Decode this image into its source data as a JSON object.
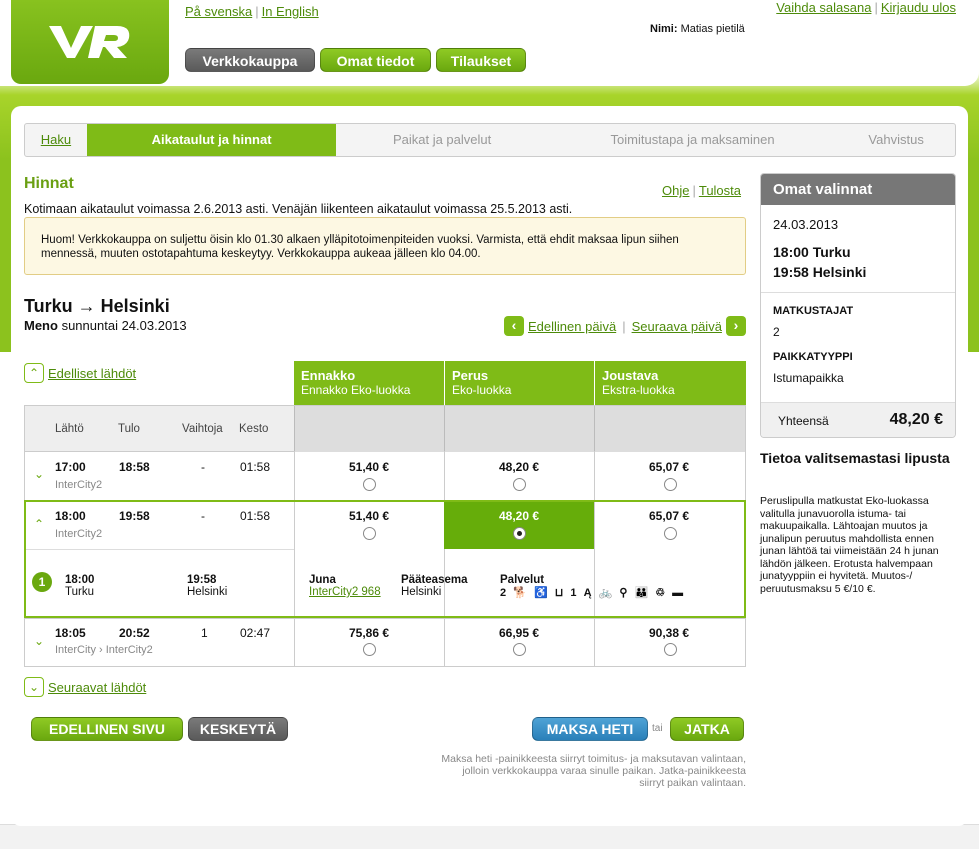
{
  "header": {
    "lang_sv": "På svenska",
    "lang_en": "In English",
    "change_password": "Vaihda salasana",
    "logout": "Kirjaudu ulos",
    "user_label": "Nimi:",
    "user_name": "Matias pietilä",
    "nav": [
      "Verkkokauppa",
      "Omat tiedot",
      "Tilaukset"
    ]
  },
  "steps": [
    "Haku",
    "Aikataulut ja hinnat",
    "Paikat ja palvelut",
    "Toimitustapa ja maksaminen",
    "Vahvistus"
  ],
  "page": {
    "title": "Hinnat",
    "help": "Ohje",
    "print": "Tulosta",
    "schedule_info": "Kotimaan aikataulut voimassa 2.6.2013 asti. Venäjän liikenteen aikataulut voimassa 25.5.2013 asti.",
    "notice": "Huom! Verkkokauppa on suljettu öisin klo 01.30 alkaen ylläpitotoimenpiteiden vuoksi. Varmista, että ehdit maksaa lipun siihen mennessä, muuten ostotapahtuma keskeytyy. Verkkokauppa aukeaa jälleen klo 04.00.",
    "route": "Turku → Helsinki",
    "direction_label": "Meno",
    "direction_date": "sunnuntai 24.03.2013",
    "prev_day": "Edellinen päivä",
    "next_day": "Seuraava päivä",
    "prev_departures": "Edelliset lähdöt",
    "next_departures": "Seuraavat lähdöt"
  },
  "fares": [
    {
      "name": "Ennakko",
      "class": "Ennakko Eko-luokka"
    },
    {
      "name": "Perus",
      "class": "Eko-luokka"
    },
    {
      "name": "Joustava",
      "class": "Ekstra-luokka"
    }
  ],
  "columns": [
    "Lähtö",
    "Tulo",
    "Vaihtoja",
    "Kesto"
  ],
  "rows": [
    {
      "dep": "17:00",
      "arr": "18:58",
      "changes": "-",
      "duration": "01:58",
      "train": "InterCity2",
      "prices": [
        "51,40 €",
        "48,20 €",
        "65,07 €"
      ]
    },
    {
      "dep": "18:00",
      "arr": "19:58",
      "changes": "-",
      "duration": "01:58",
      "train": "InterCity2",
      "prices": [
        "51,40 €",
        "48,20 €",
        "65,07 €"
      ]
    },
    {
      "dep": "18:05",
      "arr": "20:52",
      "changes": "1",
      "duration": "02:47",
      "train": "InterCity › InterCity2",
      "prices": [
        "75,86 €",
        "66,95 €",
        "90,38 €"
      ]
    }
  ],
  "detail": {
    "num": "1",
    "dep_time": "18:00",
    "dep_station": "Turku",
    "arr_time": "19:58",
    "arr_station": "Helsinki",
    "train_label": "Juna",
    "train": "InterCity2 968",
    "terminal_label": "Pääteasema",
    "terminal": "Helsinki",
    "services_label": "Palvelut"
  },
  "buttons": {
    "prev_page": "EDELLINEN SIVU",
    "cancel": "KESKEYTÄ",
    "pay_now": "MAKSA HETI",
    "or": "tai",
    "continue": "JATKA"
  },
  "footnote": "Maksa heti -painikkeesta siirryt toimitus- ja maksutavan valintaan, jolloin verkkokauppa varaa sinulle paikan. Jatka-painikkeesta siirryt paikan valintaan.",
  "sidebar": {
    "title": "Omat valinnat",
    "date": "24.03.2013",
    "dep": "18:00 Turku",
    "arr": "19:58 Helsinki",
    "passengers_label": "MATKUSTAJAT",
    "passengers": "2",
    "seat_label": "PAIKKATYYPPI",
    "seat": "Istumapaikka",
    "total_label": "Yhteensä",
    "total": "48,20 €"
  },
  "ticket_info": {
    "title": "Tietoa valitsemastasi lipusta",
    "text": "Peruslipulla matkustat Eko-luokassa valitulla junavuorolla istuma- tai makuupaikalla. Lähtoajan muutos ja junalipun peruutus mahdollista ennen junan lähtöä tai viimeistään 24 h junan lähdön jälkeen. Erotusta halvempaan junatyyppiin ei hyvitetä. Muutos-/ peruutusmaksu 5 €/10 €."
  },
  "colors": {
    "accent": "#7fbb17",
    "selected": "#66ad0a",
    "link": "#4d8b0a",
    "pay": "#2a80b9"
  }
}
